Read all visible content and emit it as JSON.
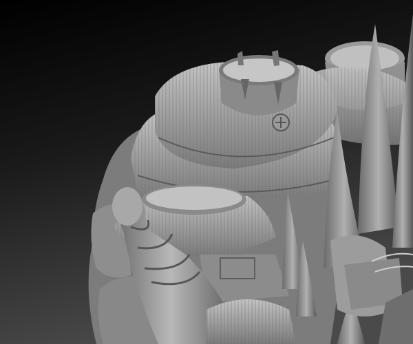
{
  "scene": {
    "subject": "sculpted-fantasy-village-model",
    "colors": {
      "background_top": "#000000",
      "background_bottom": "#4a4a4a",
      "clay_light": "#b8b8b8",
      "clay_mid": "#8a8a8a",
      "clay_dark": "#4e4e4e"
    }
  }
}
